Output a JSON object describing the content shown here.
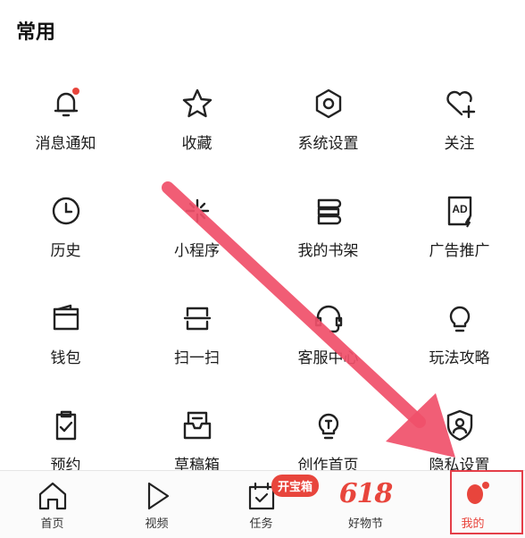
{
  "section": {
    "title": "常用"
  },
  "grid": [
    [
      {
        "label": "消息通知",
        "icon": "bell-icon"
      },
      {
        "label": "收藏",
        "icon": "star-icon"
      },
      {
        "label": "系统设置",
        "icon": "gear-icon"
      },
      {
        "label": "关注",
        "icon": "heart-plus-icon"
      }
    ],
    [
      {
        "label": "历史",
        "icon": "clock-icon"
      },
      {
        "label": "小程序",
        "icon": "sparkle-icon"
      },
      {
        "label": "我的书架",
        "icon": "bookshelf-icon"
      },
      {
        "label": "广告推广",
        "icon": "ad-icon"
      }
    ],
    [
      {
        "label": "钱包",
        "icon": "wallet-icon"
      },
      {
        "label": "扫一扫",
        "icon": "scan-icon"
      },
      {
        "label": "客服中心",
        "icon": "headset-icon"
      },
      {
        "label": "玩法攻略",
        "icon": "lightbulb-icon"
      }
    ],
    [
      {
        "label": "预约",
        "icon": "clipboard-check-icon"
      },
      {
        "label": "草稿箱",
        "icon": "draft-box-icon"
      },
      {
        "label": "创作首页",
        "icon": "creator-bulb-icon"
      },
      {
        "label": "隐私设置",
        "icon": "privacy-shield-icon"
      }
    ]
  ],
  "tabbar": {
    "items": [
      {
        "label": "首页",
        "icon": "home-icon"
      },
      {
        "label": "视频",
        "icon": "play-icon"
      },
      {
        "label": "任务",
        "icon": "task-calendar-icon"
      },
      {
        "label": "好物节",
        "icon": "618-logo"
      },
      {
        "label": "我的",
        "icon": "avatar-icon"
      }
    ],
    "badge": "开宝箱",
    "promo_logo": "618",
    "active_index": 4
  },
  "colors": {
    "accent": "#e8453c",
    "arrow": "#f0506a",
    "highlight_box": "#e43e48"
  }
}
